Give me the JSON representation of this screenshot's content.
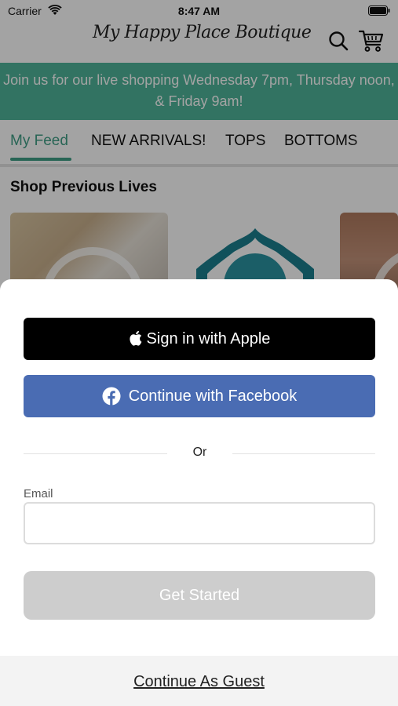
{
  "status_bar": {
    "carrier": "Carrier",
    "time": "8:47 AM",
    "icons": [
      "wifi-icon",
      "battery-icon"
    ]
  },
  "header": {
    "logo_text": "My Happy Place Boutique",
    "icons": [
      "search-icon",
      "cart-icon"
    ]
  },
  "banner": {
    "text": "Join us for our live shopping Wednesday 7pm, Thursday noon, & Friday 9am!",
    "color": "#4fb599"
  },
  "tabs": [
    {
      "label": "My Feed",
      "active": true
    },
    {
      "label": "NEW ARRIVALS!",
      "active": false
    },
    {
      "label": "TOPS",
      "active": false
    },
    {
      "label": "BOTTOMS",
      "active": false
    }
  ],
  "feed": {
    "section_title": "Shop Previous Lives"
  },
  "sheet": {
    "apple_button": "Sign in with Apple",
    "facebook_button": "Continue with Facebook",
    "divider_text": "Or",
    "email_label": "Email",
    "email_value": "",
    "email_placeholder": "",
    "get_started_button": "Get Started",
    "guest_link": "Continue As Guest"
  },
  "colors": {
    "accent": "#3f9e86",
    "facebook": "#4a6cb3",
    "apple": "#000000",
    "disabled_button": "#cdcdcd"
  }
}
